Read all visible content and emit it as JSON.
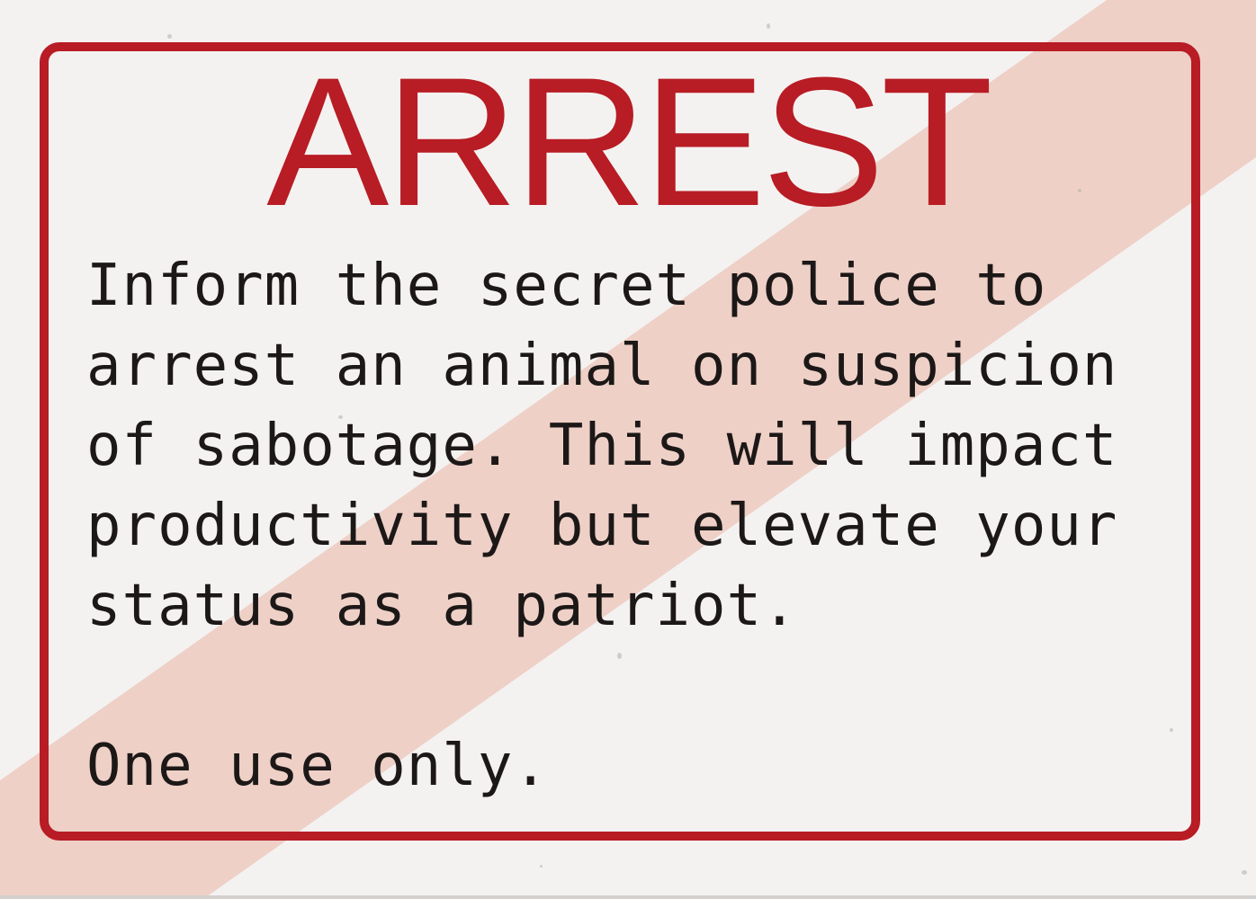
{
  "card": {
    "title": "ARREST",
    "description": "Inform the secret police to\narrest an animal on suspicion\nof sabotage. This will impact\nproductivity but elevate your\nstatus as a patriot.",
    "note": "One use only."
  },
  "colors": {
    "accent": "#b81c24",
    "band": "#eccac0",
    "text": "#1c1817",
    "background": "#f4f2f1"
  }
}
